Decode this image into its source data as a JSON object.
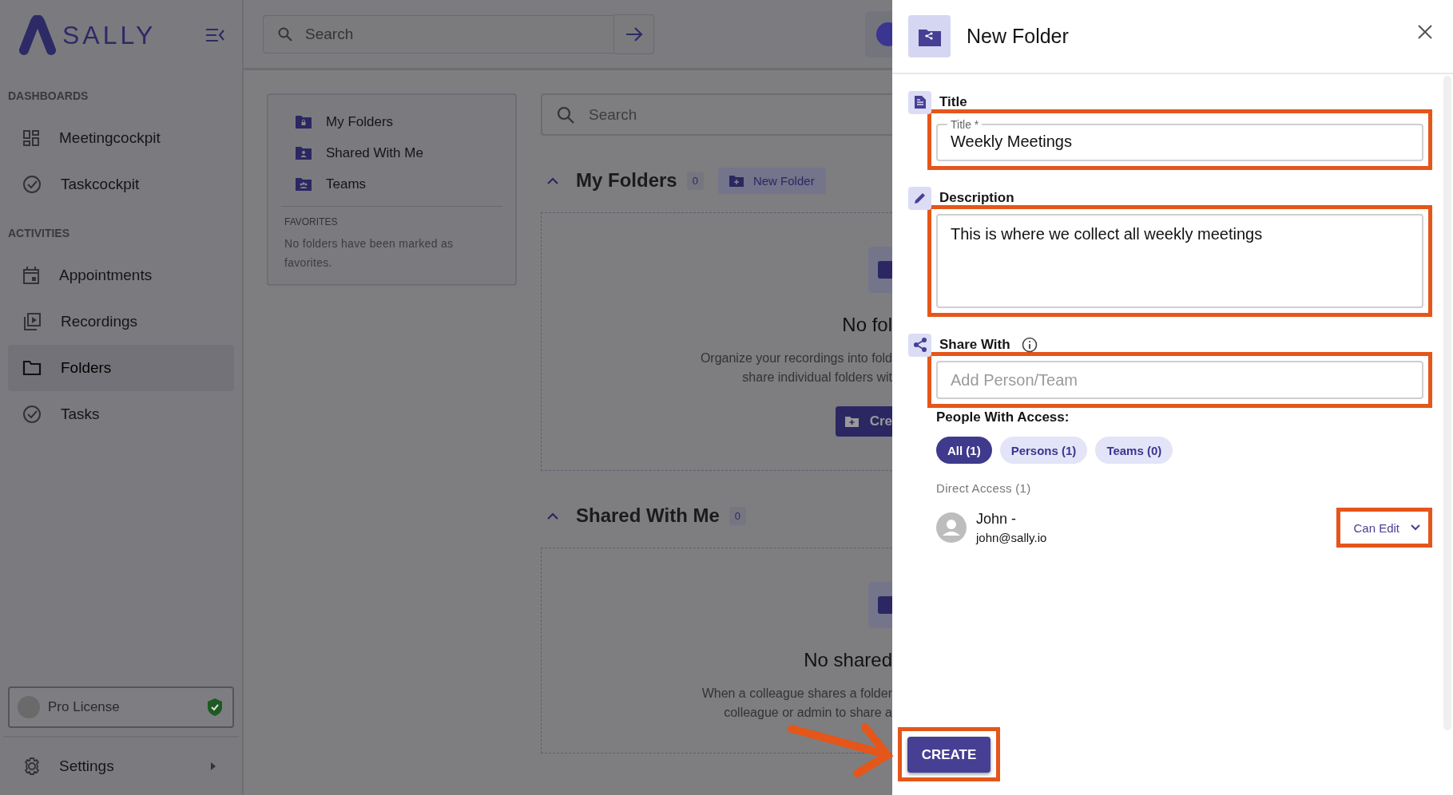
{
  "sidebar": {
    "logo_text": "SALLY",
    "sections": [
      {
        "heading": "DASHBOARDS",
        "items": [
          {
            "label": "Meetingcockpit",
            "selected": false
          },
          {
            "label": "Taskcockpit",
            "selected": false
          }
        ]
      },
      {
        "heading": "ACTIVITIES",
        "items": [
          {
            "label": "Appointments",
            "selected": false
          },
          {
            "label": "Recordings",
            "selected": false
          },
          {
            "label": "Folders",
            "selected": true
          },
          {
            "label": "Tasks",
            "selected": false
          }
        ]
      }
    ],
    "license": "Pro License",
    "settings": "Settings"
  },
  "topbar": {
    "search_placeholder": "Search"
  },
  "folder_nav": {
    "items": [
      {
        "label": "My Folders"
      },
      {
        "label": "Shared With Me"
      },
      {
        "label": "Teams"
      }
    ],
    "favorites_heading": "FAVORITES",
    "favorites_text": "No folders have been marked as favorites."
  },
  "main": {
    "search_placeholder": "Search",
    "sections": [
      {
        "title": "My Folders",
        "count": "0",
        "button": "New Folder",
        "empty_title": "No fol",
        "empty_lines": [
          "Organize your recordings into fold",
          "share individual folders wit"
        ],
        "action": "Cre"
      },
      {
        "title": "Shared With Me",
        "count": "0",
        "empty_title": "No shared",
        "empty_lines": [
          "When a colleague shares a folder",
          "colleague or admin to share a"
        ]
      }
    ]
  },
  "panel": {
    "title": "New Folder",
    "title_section": "Title",
    "title_field_label": "Title *",
    "title_value": "Weekly Meetings",
    "description_section": "Description",
    "description_value": "This is where we collect all weekly meetings",
    "share_section": "Share With",
    "share_placeholder": "Add Person/Team",
    "access_heading": "People With Access:",
    "filters": [
      {
        "label": "All (1)",
        "selected": true
      },
      {
        "label": "Persons (1)",
        "selected": false
      },
      {
        "label": "Teams (0)",
        "selected": false
      }
    ],
    "direct_access_heading": "Direct Access (1)",
    "people": [
      {
        "name": "John -",
        "email": "john@sally.io",
        "permission": "Can Edit"
      }
    ],
    "create_button": "CREATE"
  }
}
